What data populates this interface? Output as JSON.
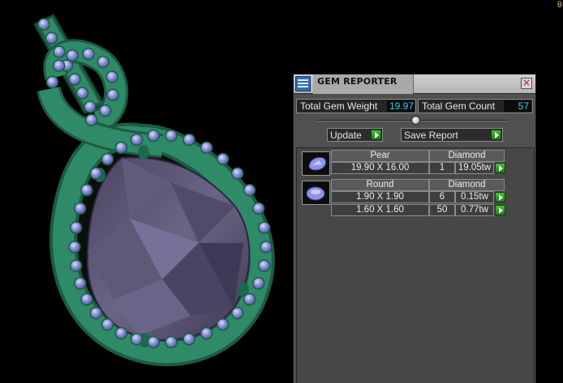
{
  "app": {
    "corner_glyph": "θ"
  },
  "panel": {
    "title": "GEM REPORTER",
    "close_symbol": "×",
    "icon": "gem-reporter-icon",
    "stats": {
      "weight_label": "Total Gem Weight",
      "weight_value": "19.97",
      "count_label": "Total Gem Count",
      "count_value": "57"
    },
    "slider": {
      "value_fraction": 0.5
    },
    "update_label": "Update",
    "save_report_label": "Save Report",
    "groups": [
      {
        "shape": "Pear",
        "material": "Diamond",
        "thumbnail_icon": "pear-gem-icon",
        "rows": [
          {
            "size": "19.90 X 16.00",
            "count": "1",
            "weight": "19.05tw"
          }
        ]
      },
      {
        "shape": "Round",
        "material": "Diamond",
        "thumbnail_icon": "round-gem-icon",
        "rows": [
          {
            "size": "1.90 X 1.90",
            "count": "6",
            "weight": "0.15tw"
          },
          {
            "size": "1.60 X 1.60",
            "count": "50",
            "weight": "0.77tw"
          }
        ]
      }
    ]
  },
  "colors": {
    "metal": "#2f8a68",
    "metal_dark": "#1c5c43",
    "center_stone": "#5a5373",
    "accent_stone": "#8d93d8",
    "value_text": "#2fd0e8",
    "go_button": "#32a02a"
  }
}
